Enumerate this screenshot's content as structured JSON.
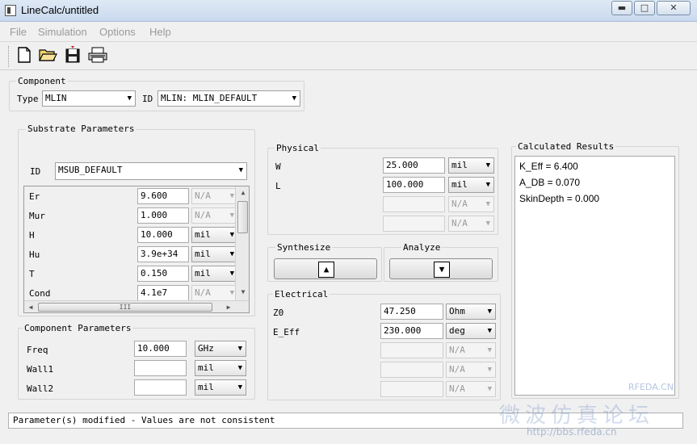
{
  "window": {
    "title": "LineCalc/untitled"
  },
  "menu": [
    "File",
    "Simulation",
    "Options",
    "Help"
  ],
  "component": {
    "group_label": "Component",
    "type_label": "Type",
    "type_value": "MLIN",
    "id_label": "ID",
    "id_value": "MLIN: MLIN_DEFAULT"
  },
  "substrate": {
    "group_label": "Substrate Parameters",
    "id_label": "ID",
    "id_value": "MSUB_DEFAULT",
    "params": [
      {
        "name": "Er",
        "value": "9.600",
        "unit": "N/A",
        "unit_enabled": false
      },
      {
        "name": "Mur",
        "value": "1.000",
        "unit": "N/A",
        "unit_enabled": false
      },
      {
        "name": "H",
        "value": "10.000",
        "unit": "mil",
        "unit_enabled": true
      },
      {
        "name": "Hu",
        "value": "3.9e+34",
        "unit": "mil",
        "unit_enabled": true
      },
      {
        "name": "T",
        "value": "0.150",
        "unit": "mil",
        "unit_enabled": true
      },
      {
        "name": "Cond",
        "value": "4.1e7",
        "unit": "N/A",
        "unit_enabled": false
      }
    ],
    "hscroll_grip": "III"
  },
  "component_params": {
    "group_label": "Component Parameters",
    "params": [
      {
        "name": "Freq",
        "value": "10.000",
        "unit": "GHz"
      },
      {
        "name": "Wall1",
        "value": "",
        "unit": "mil"
      },
      {
        "name": "Wall2",
        "value": "",
        "unit": "mil"
      }
    ]
  },
  "physical": {
    "group_label": "Physical",
    "params": [
      {
        "name": "W",
        "value": "25.000",
        "unit": "mil",
        "enabled": true
      },
      {
        "name": "L",
        "value": "100.000",
        "unit": "mil",
        "enabled": true
      },
      {
        "name": "",
        "value": "",
        "unit": "N/A",
        "enabled": false
      },
      {
        "name": "",
        "value": "",
        "unit": "N/A",
        "enabled": false
      }
    ]
  },
  "synthesize": {
    "group_label": "Synthesize",
    "glyph": "▲"
  },
  "analyze": {
    "group_label": "Analyze",
    "glyph": "▼"
  },
  "electrical": {
    "group_label": "Electrical",
    "params": [
      {
        "name": "Z0",
        "value": "47.250",
        "unit": "Ohm",
        "enabled": true
      },
      {
        "name": "E_Eff",
        "value": "230.000",
        "unit": "deg",
        "enabled": true
      },
      {
        "name": "",
        "value": "",
        "unit": "N/A",
        "enabled": false
      },
      {
        "name": "",
        "value": "",
        "unit": "N/A",
        "enabled": false
      },
      {
        "name": "",
        "value": "",
        "unit": "N/A",
        "enabled": false
      }
    ]
  },
  "results": {
    "group_label": "Calculated Results",
    "lines": [
      "K_Eff = 6.400",
      "A_DB = 0.070",
      "SkinDepth = 0.000"
    ]
  },
  "status": "Parameter(s) modified - Values are not consistent",
  "watermark": {
    "chinese": "微波仿真论坛",
    "url": "http://bbs.rfeda.cn",
    "site": "RFEDA.CN"
  },
  "icons": [
    "new-file-icon",
    "open-folder-icon",
    "save-icon",
    "print-icon"
  ]
}
